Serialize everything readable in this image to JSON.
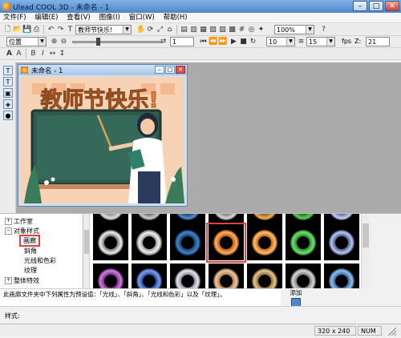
{
  "window": {
    "title": "Ulead COOL 3D - 未命名 - 1"
  },
  "menu": [
    "文件(F)",
    "编辑(E)",
    "查看(V)",
    "图像(I)",
    "窗口(W)",
    "帮助(H)"
  ],
  "toolbar1": {
    "text_combo": "教师节快乐!",
    "zoom_combo": "100%"
  },
  "toolbar2": {
    "position_combo": "位置",
    "frame_value": "1",
    "frame_total": "10",
    "fps_value": "15",
    "fps_label": "fps",
    "z_label": "Z:",
    "z_value": "21"
  },
  "document": {
    "title": "未命名 - 1",
    "headline": "教师节快乐!"
  },
  "tree": {
    "items": [
      {
        "label": "工作室",
        "expander": "+"
      },
      {
        "label": "对象样式",
        "expander": "−"
      },
      {
        "label": "画廊",
        "expander": ""
      },
      {
        "label": "斜角",
        "expander": ""
      },
      {
        "label": "光线和色彩",
        "expander": ""
      },
      {
        "label": "纹理",
        "expander": ""
      },
      {
        "label": "整体特效",
        "expander": "+"
      }
    ]
  },
  "description": "此画廊文件夹中下列属性为预设值：「光线」、「斜角」、「光线和色彩」以及「纹理」。",
  "add_button": {
    "label": "添加"
  },
  "style_bar": {
    "label": "样式:"
  },
  "status": {
    "size": "320 x 240",
    "num": "NUM"
  },
  "colors": {
    "selection": "#e0433a",
    "canvas_bg": "#f8d2b4",
    "board": "#2f5a4c",
    "title_orange": "#e9803a"
  }
}
